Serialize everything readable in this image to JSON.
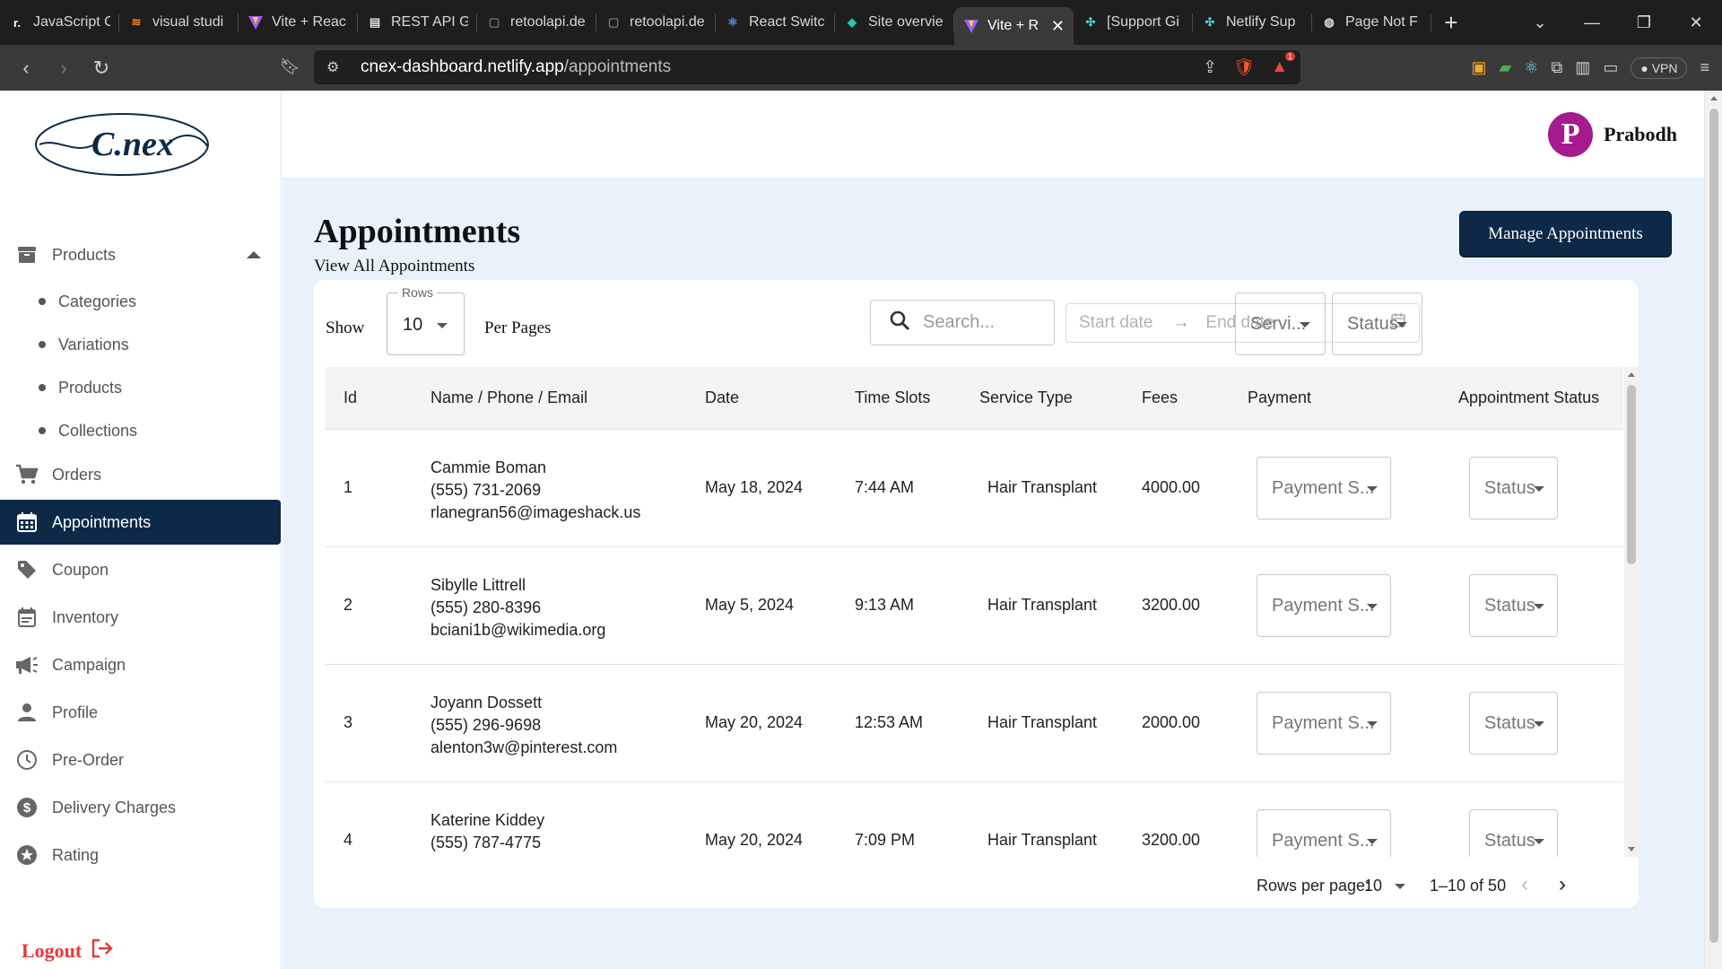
{
  "browser": {
    "tabs": [
      {
        "title": "JavaScript C",
        "icon": "repl-icon"
      },
      {
        "title": "visual studi",
        "icon": "stackoverflow-icon"
      },
      {
        "title": "Vite + Reac",
        "icon": "vite-icon"
      },
      {
        "title": "REST API Gi",
        "icon": "doc-icon"
      },
      {
        "title": "retoolapi.de",
        "icon": "page-icon"
      },
      {
        "title": "retoolapi.de",
        "icon": "page-icon"
      },
      {
        "title": "React Switc",
        "icon": "react-icon"
      },
      {
        "title": "Site overvie",
        "icon": "netlify-icon"
      },
      {
        "title": "Vite + R",
        "icon": "vite-icon",
        "active": true
      },
      {
        "title": "[Support Gi",
        "icon": "netlify-icon"
      },
      {
        "title": "Netlify Sup",
        "icon": "netlify-icon"
      },
      {
        "title": "Page Not F",
        "icon": "globe-icon"
      }
    ],
    "url_host": "cnex-dashboard.netlify.app",
    "url_path": "/appointments",
    "vpn_label": "VPN",
    "notification_count": "1"
  },
  "sidebar": {
    "logo_text": "C.nex",
    "items": [
      {
        "label": "Products",
        "icon": "archive-icon",
        "expanded": true
      },
      {
        "label": "Orders",
        "icon": "cart-icon"
      },
      {
        "label": "Appointments",
        "icon": "calendar-icon",
        "active": true
      },
      {
        "label": "Coupon",
        "icon": "tag-icon"
      },
      {
        "label": "Inventory",
        "icon": "event-note-icon"
      },
      {
        "label": "Campaign",
        "icon": "megaphone-icon"
      },
      {
        "label": "Profile",
        "icon": "person-icon"
      },
      {
        "label": "Pre-Order",
        "icon": "clock-icon"
      },
      {
        "label": "Delivery Charges",
        "icon": "dollar-icon"
      },
      {
        "label": "Rating",
        "icon": "star-icon"
      }
    ],
    "product_subitems": [
      "Categories",
      "Variations",
      "Products",
      "Collections"
    ],
    "logout_label": "Logout"
  },
  "header": {
    "avatar_letter": "P",
    "user_name": "Prabodh"
  },
  "main": {
    "title": "Appointments",
    "subtitle": "View All Appointments",
    "manage_button": "Manage Appointments",
    "show_label": "Show",
    "rows_legend": "Rows",
    "rows_value": "10",
    "per_pages_label": "Per Pages",
    "search_placeholder": "Search...",
    "start_date_placeholder": "Start date",
    "end_date_placeholder": "End date",
    "service_filter": "Servi...",
    "status_filter": "Status"
  },
  "table": {
    "columns": [
      "Id",
      "Name / Phone / Email",
      "Date",
      "Time Slots",
      "Service Type",
      "Fees",
      "Payment",
      "Appointment Status"
    ],
    "rows": [
      {
        "id": "1",
        "name": "Cammie Boman",
        "phone": "(555) 731-2069",
        "email": "rlanegran56@imageshack.us",
        "date": "May 18, 2024",
        "time": "7:44 AM",
        "service": "Hair Transplant",
        "fees": "4000.00",
        "payment": "Payment S...",
        "status": "Status"
      },
      {
        "id": "2",
        "name": "Sibylle Littrell",
        "phone": "(555) 280-8396",
        "email": "bciani1b@wikimedia.org",
        "date": "May 5, 2024",
        "time": "9:13 AM",
        "service": "Hair Transplant",
        "fees": "3200.00",
        "payment": "Payment S...",
        "status": "Status"
      },
      {
        "id": "3",
        "name": "Joyann Dossett",
        "phone": "(555) 296-9698",
        "email": "alenton3w@pinterest.com",
        "date": "May 20, 2024",
        "time": "12:53 AM",
        "service": "Hair Transplant",
        "fees": "2000.00",
        "payment": "Payment S...",
        "status": "Status"
      },
      {
        "id": "4",
        "name": "Katerine Kiddey",
        "phone": "(555) 787-4775",
        "email": "",
        "date": "May 20, 2024",
        "time": "7:09 PM",
        "service": "Hair Transplant",
        "fees": "3200.00",
        "payment": "Payment S...",
        "status": "Status"
      }
    ]
  },
  "pagination": {
    "rows_per_page_label": "Rows per page:",
    "rows_per_page_value": "10",
    "range": "1–10 of 50"
  },
  "colors": {
    "accent": "#0c2a47",
    "content_bg": "#e9f2fb",
    "avatar": "#a51a8e",
    "logout": "#e53935"
  }
}
